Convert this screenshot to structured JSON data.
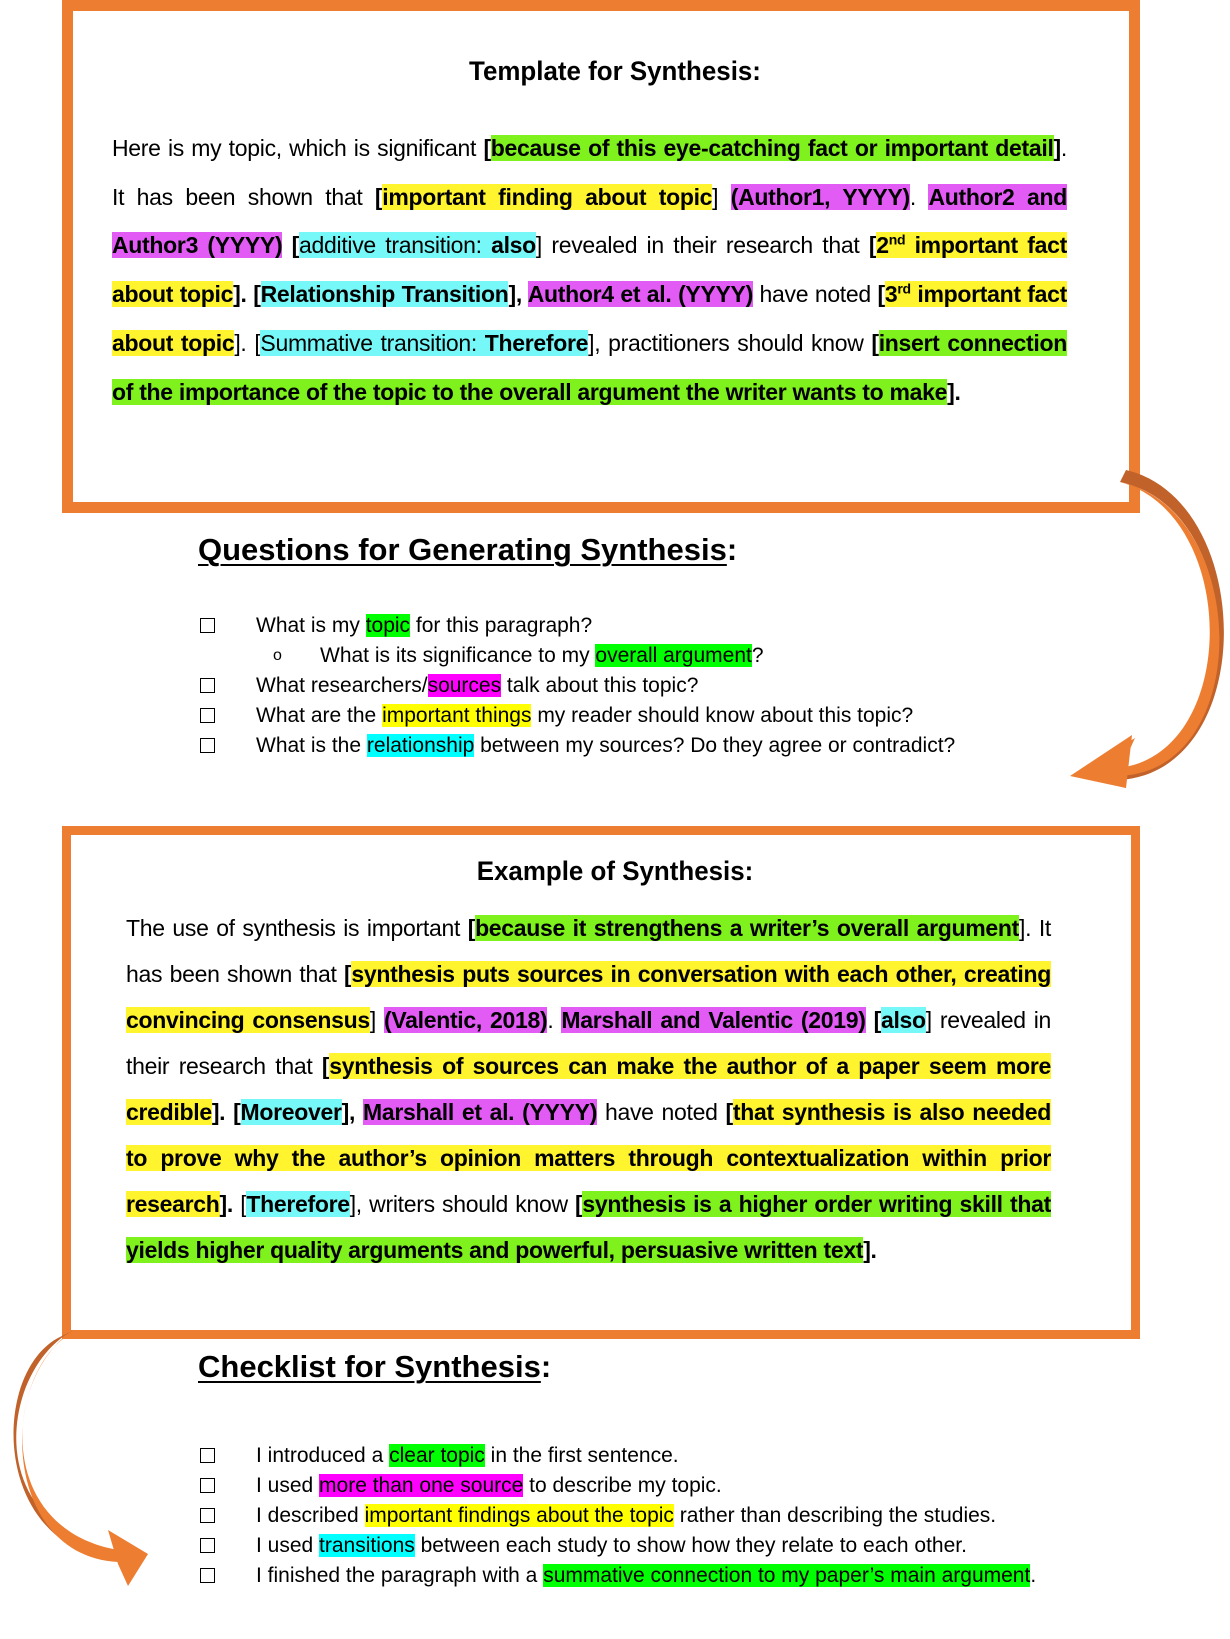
{
  "template": {
    "title": "Template for Synthesis:",
    "paragraph": [
      {
        "t": "Here is my topic, which is significant ",
        "s": ""
      },
      {
        "t": "[",
        "s": "b"
      },
      {
        "t": "because of this eye-catching fact or important detail",
        "s": "b hg"
      },
      {
        "t": "]",
        "s": "b"
      },
      {
        "t": ". It has been shown that ",
        "s": ""
      },
      {
        "t": "[",
        "s": "b"
      },
      {
        "t": "important finding about topic",
        "s": "b hy"
      },
      {
        "t": "] ",
        "s": ""
      },
      {
        "t": "(Author1, YYYY)",
        "s": "b hm"
      },
      {
        "t": ". ",
        "s": ""
      },
      {
        "t": "Author2 and Author3 (YYYY)",
        "s": "b hm"
      },
      {
        "t": " [",
        "s": "b"
      },
      {
        "t": "additive transition: ",
        "s": "hc"
      },
      {
        "t": "also",
        "s": "b hc"
      },
      {
        "t": "] revealed in their research that ",
        "s": ""
      },
      {
        "t": "[",
        "s": "b"
      },
      {
        "t": "2",
        "s": "b hy",
        "sup": "nd"
      },
      {
        "t": " important fact about topic",
        "s": "b hy"
      },
      {
        "t": "]. [",
        "s": "b"
      },
      {
        "t": "Relationship Transition",
        "s": "b hc"
      },
      {
        "t": "], ",
        "s": "b"
      },
      {
        "t": "Author4 et al. (YYYY)",
        "s": "b hm"
      },
      {
        "t": " have noted ",
        "s": ""
      },
      {
        "t": "[",
        "s": "b"
      },
      {
        "t": "3",
        "s": "b hy",
        "sup": "rd"
      },
      {
        "t": " important fact about topic",
        "s": "b hy"
      },
      {
        "t": "]. [",
        "s": ""
      },
      {
        "t": "Summative transition: ",
        "s": "hc"
      },
      {
        "t": "Therefore",
        "s": "b hc"
      },
      {
        "t": "], practitioners should know ",
        "s": ""
      },
      {
        "t": "[",
        "s": "b"
      },
      {
        "t": "insert connection of the importance of the topic to the overall argument the writer wants to make",
        "s": "b hg"
      },
      {
        "t": "].",
        "s": "b"
      }
    ]
  },
  "questions": {
    "title": "Questions for Generating Synthesis",
    "title_suffix": ":",
    "items": [
      {
        "sub": false,
        "parts": [
          {
            "t": "What is my ",
            "h": ""
          },
          {
            "t": "topic",
            "h": "lg"
          },
          {
            "t": " for this paragraph?",
            "h": ""
          }
        ]
      },
      {
        "sub": true,
        "bullet": "o",
        "parts": [
          {
            "t": "What is its significance to my ",
            "h": ""
          },
          {
            "t": "overall argument",
            "h": "lg"
          },
          {
            "t": "?",
            "h": ""
          }
        ]
      },
      {
        "sub": false,
        "parts": [
          {
            "t": "What researchers/",
            "h": ""
          },
          {
            "t": "sources",
            "h": "lm"
          },
          {
            "t": " talk about this topic?",
            "h": ""
          }
        ]
      },
      {
        "sub": false,
        "parts": [
          {
            "t": "What are the ",
            "h": ""
          },
          {
            "t": "important things",
            "h": "ly"
          },
          {
            "t": " my reader should know about this topic?",
            "h": ""
          }
        ]
      },
      {
        "sub": false,
        "parts": [
          {
            "t": "What is the ",
            "h": ""
          },
          {
            "t": "relationship",
            "h": "lc"
          },
          {
            "t": " between my sources? Do they agree or contradict?",
            "h": ""
          }
        ]
      }
    ]
  },
  "example": {
    "title": "Example of Synthesis:",
    "paragraph": [
      {
        "t": "The use of synthesis is important ",
        "s": ""
      },
      {
        "t": "[",
        "s": "b"
      },
      {
        "t": "because it strengthens a writer’s overall argument",
        "s": "b hg"
      },
      {
        "t": "]. It has been shown that ",
        "s": ""
      },
      {
        "t": "[",
        "s": "b"
      },
      {
        "t": "synthesis puts sources in conversation with each other, creating convincing consensus",
        "s": "b hy"
      },
      {
        "t": "] ",
        "s": ""
      },
      {
        "t": "(Valentic, 2018)",
        "s": "b hm"
      },
      {
        "t": ". ",
        "s": ""
      },
      {
        "t": "Marshall and Valentic (2019)",
        "s": "b hm"
      },
      {
        "t": " [",
        "s": "b"
      },
      {
        "t": "also",
        "s": "b hc"
      },
      {
        "t": "] revealed in their research that ",
        "s": ""
      },
      {
        "t": "[",
        "s": "b"
      },
      {
        "t": "synthesis of sources can make the author of a paper seem more credible",
        "s": "b hy"
      },
      {
        "t": "]. [",
        "s": "b"
      },
      {
        "t": "Moreover",
        "s": "b hc"
      },
      {
        "t": "], ",
        "s": "b"
      },
      {
        "t": "Marshall et al. (YYYY)",
        "s": "b hm"
      },
      {
        "t": " have noted ",
        "s": ""
      },
      {
        "t": "[",
        "s": "b"
      },
      {
        "t": "that synthesis is also needed to prove why the author’s opinion matters through contextualization within prior research",
        "s": "b hy"
      },
      {
        "t": "].",
        "s": "b"
      },
      {
        "t": " [",
        "s": ""
      },
      {
        "t": "Therefore",
        "s": "b hc"
      },
      {
        "t": "], writers should know ",
        "s": ""
      },
      {
        "t": "[",
        "s": "b"
      },
      {
        "t": "synthesis is a higher order writing skill that yields higher quality arguments and powerful, persuasive written text",
        "s": "b hg"
      },
      {
        "t": "].",
        "s": "b"
      }
    ]
  },
  "checklist": {
    "title": "Checklist for Synthesis",
    "title_suffix": ":",
    "items": [
      {
        "parts": [
          {
            "t": "I introduced a ",
            "h": ""
          },
          {
            "t": "clear topic",
            "h": "lg"
          },
          {
            "t": " in the first sentence.",
            "h": ""
          }
        ]
      },
      {
        "parts": [
          {
            "t": "I used ",
            "h": ""
          },
          {
            "t": "more than one source",
            "h": "lm"
          },
          {
            "t": " to describe my topic.",
            "h": ""
          }
        ]
      },
      {
        "parts": [
          {
            "t": "I described ",
            "h": ""
          },
          {
            "t": "important findings about the topic",
            "h": "ly"
          },
          {
            "t": " rather than describing the studies.",
            "h": ""
          }
        ]
      },
      {
        "parts": [
          {
            "t": "I used ",
            "h": ""
          },
          {
            "t": "transitions",
            "h": "lc"
          },
          {
            "t": " between each study to show how they relate to each other.",
            "h": ""
          }
        ]
      },
      {
        "parts": [
          {
            "t": "I finished the paragraph with a ",
            "h": ""
          },
          {
            "t": "summative connection to my paper’s main argument",
            "h": "lg"
          },
          {
            "t": ".",
            "h": ""
          }
        ]
      }
    ]
  },
  "colors": {
    "frame": "#ED7D31",
    "arrow_shadow": "#C0622A",
    "para_green": "#7FF11D",
    "para_yellow": "#FFF42E",
    "para_magenta": "#E25BF5",
    "para_cyan": "#77F8F8",
    "list_green": "#00FF00",
    "list_magenta": "#FF00FF",
    "list_yellow": "#FFFF00",
    "list_cyan": "#00FFFF"
  },
  "icons": {
    "checkbox": "empty-checkbox-icon",
    "sub_bullet": "hollow-circle-bullet-icon",
    "arrow_right": "curved-arrow-down-left-icon",
    "arrow_left": "curved-arrow-down-right-icon"
  }
}
